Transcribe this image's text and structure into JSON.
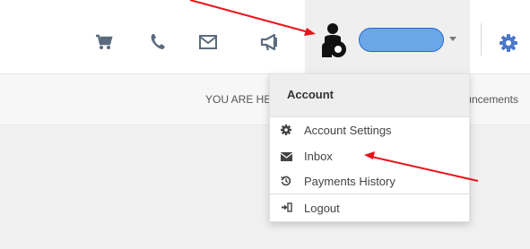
{
  "header": {
    "icons": [
      "shopping-cart-icon",
      "phone-icon",
      "envelope-icon",
      "megaphone-icon"
    ],
    "user": {
      "avatar_icon": "user-avatar-icon",
      "name_redacted": true,
      "dropdown_caret": "caret-down-icon"
    },
    "settings_icon": "gear-icon"
  },
  "breadcrumb": {
    "left_text": "YOU ARE HERE",
    "right_text": "Announcements"
  },
  "dropdown": {
    "title": "Account",
    "items": [
      {
        "icon": "gear-icon",
        "label": "Account Settings"
      },
      {
        "icon": "envelope-icon",
        "label": "Inbox"
      },
      {
        "icon": "history-icon",
        "label": "Payments History"
      },
      {
        "icon": "logout-icon",
        "label": "Logout"
      }
    ]
  },
  "annotations": {
    "arrow_color": "#e8141b"
  },
  "colors": {
    "accent": "#4a79c9",
    "icon_gray": "#5b6b7f",
    "pill_fill": "#6aa6e8",
    "pill_border": "#2366c9"
  }
}
